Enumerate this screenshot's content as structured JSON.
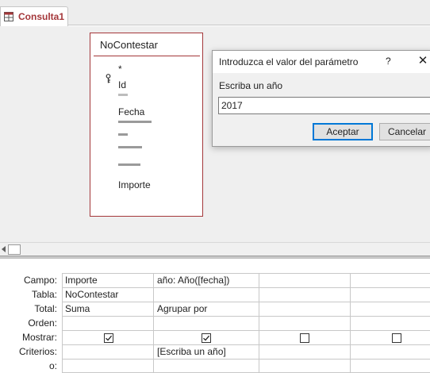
{
  "tab": {
    "label": "Consulta1"
  },
  "field_list": {
    "title": "NoContestar",
    "fields": [
      "*",
      "Id",
      "Fecha",
      "Importe"
    ]
  },
  "dialog": {
    "title": "Introduzca el valor del parámetro",
    "help": "?",
    "close": "✕",
    "prompt": "Escriba un año",
    "value": "2017",
    "ok_label": "Aceptar",
    "cancel_label": "Cancelar"
  },
  "grid": {
    "row_labels": [
      "Campo:",
      "Tabla:",
      "Total:",
      "Orden:",
      "Mostrar:",
      "Criterios:",
      "o:"
    ],
    "columns": [
      {
        "campo": "Importe",
        "tabla": "NoContestar",
        "total": "Suma",
        "orden": "",
        "mostrar": true,
        "criterios": ""
      },
      {
        "campo": "año: Año([fecha])",
        "tabla": "",
        "total": "Agrupar por",
        "orden": "",
        "mostrar": true,
        "criterios": "[Escriba un año]"
      },
      {
        "campo": "",
        "tabla": "",
        "total": "",
        "orden": "",
        "mostrar": false,
        "criterios": ""
      },
      {
        "campo": "",
        "tabla": "",
        "total": "",
        "orden": "",
        "mostrar": false,
        "criterios": ""
      }
    ]
  },
  "colors": {
    "accent": "#a4373a",
    "default_button": "#0078d7"
  }
}
